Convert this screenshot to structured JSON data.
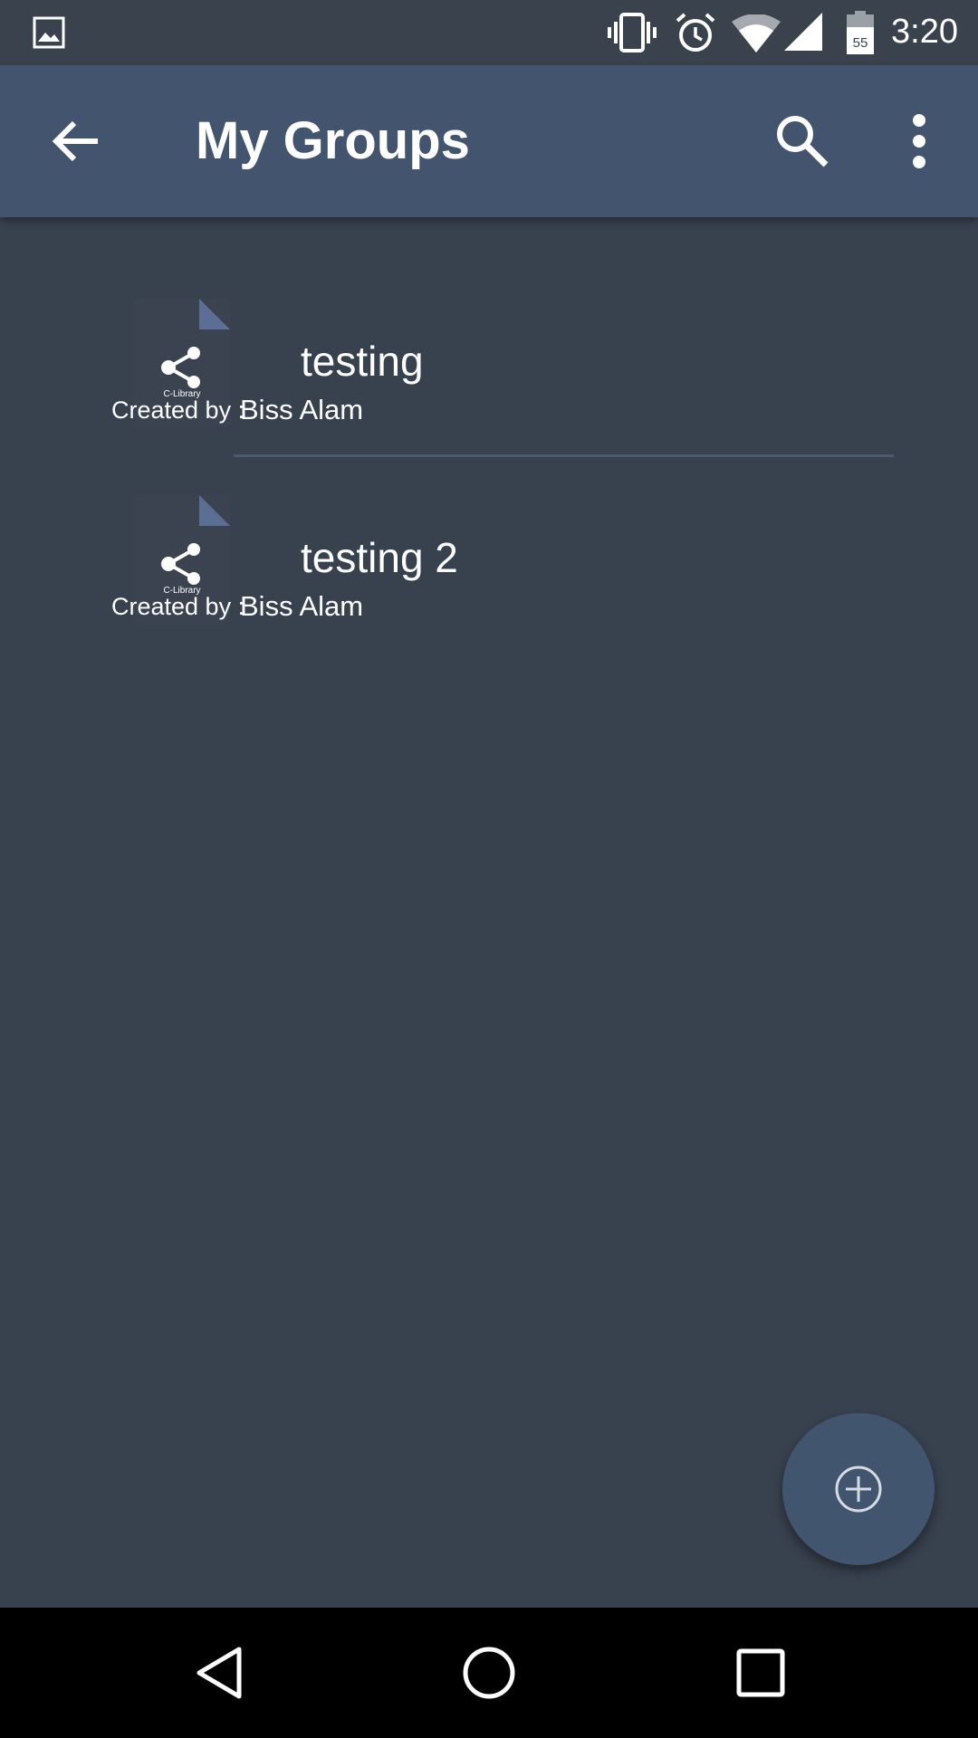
{
  "status_bar": {
    "time": "3:20",
    "battery_level": "55",
    "icons": [
      "gallery-icon",
      "vibrate-icon",
      "alarm-icon",
      "wifi-icon",
      "signal-icon",
      "battery-icon"
    ]
  },
  "app_bar": {
    "title": "My Groups",
    "icons": [
      "back-arrow-icon",
      "search-icon",
      "more-vert-icon"
    ],
    "color": "#43546f"
  },
  "groups": [
    {
      "name": "testing",
      "thumbnail_label": "C-Library",
      "created_by_label": "Created by :",
      "created_by": "Biss Alam"
    },
    {
      "name": "testing 2",
      "thumbnail_label": "C-Library",
      "created_by_label": "Created by :",
      "created_by": "Biss Alam"
    }
  ],
  "fab": {
    "icon": "add-circle-icon"
  },
  "nav_bar": {
    "icons": [
      "nav-back-icon",
      "nav-home-icon",
      "nav-recents-icon"
    ]
  },
  "colors": {
    "background": "#38414e",
    "app_bar": "#43546f",
    "fab": "#42556f",
    "accent": "#5b6f95"
  }
}
